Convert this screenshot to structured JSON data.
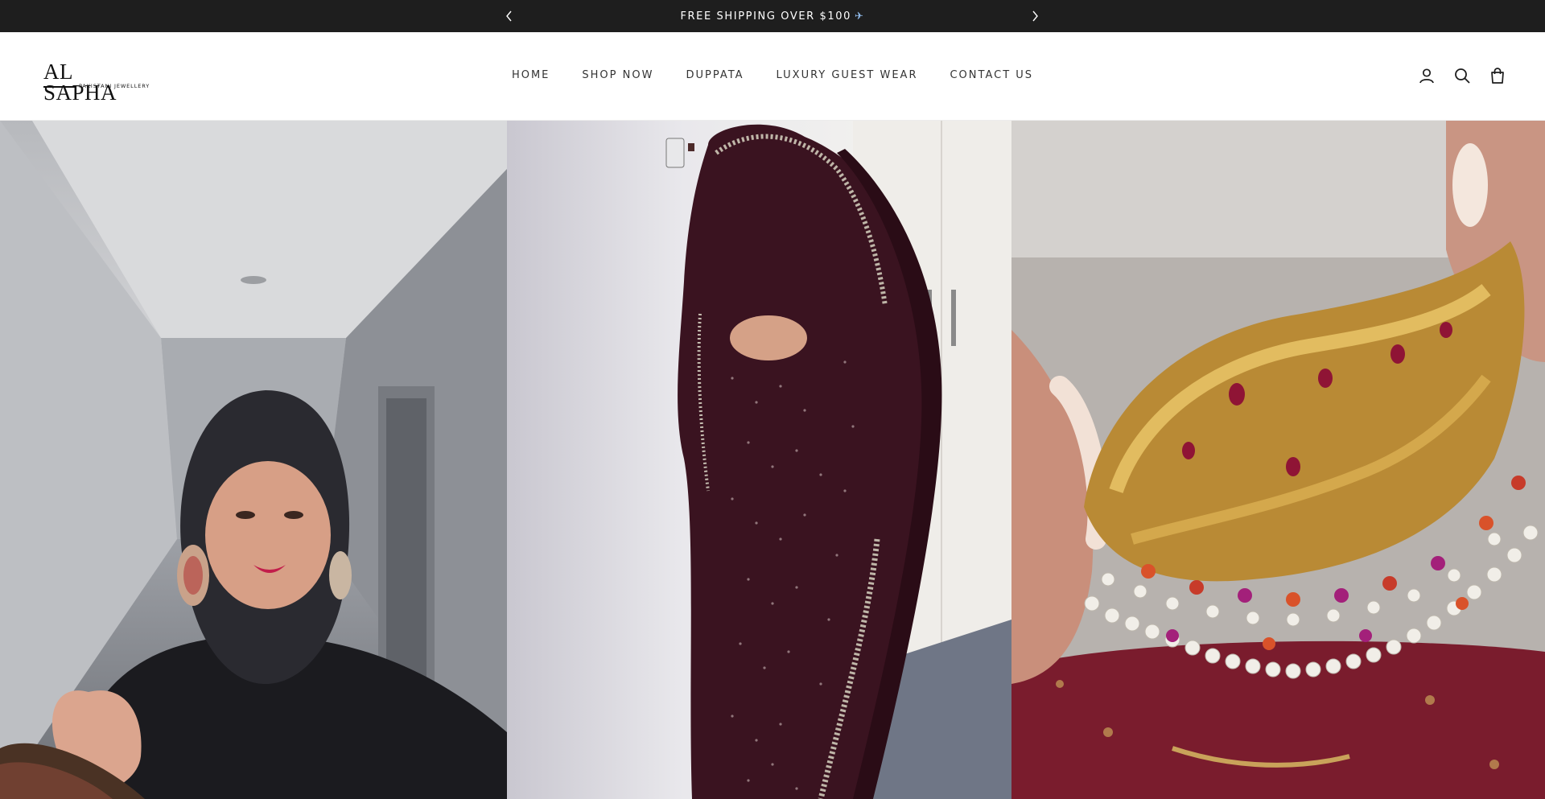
{
  "announcement": {
    "text": "FREE SHIPPING OVER $100",
    "emoji": "✈",
    "prev_icon": "chevron-left-icon",
    "next_icon": "chevron-right-icon"
  },
  "brand": {
    "name": "AL SAPHA",
    "tagline": "PAKISTANI JEWELLERY"
  },
  "nav": {
    "items": [
      {
        "label": "HOME"
      },
      {
        "label": "SHOP NOW"
      },
      {
        "label": "DUPPATA"
      },
      {
        "label": "LUXURY GUEST WEAR"
      },
      {
        "label": "CONTACT US"
      }
    ]
  },
  "header_icons": [
    "account-icon",
    "search-icon",
    "cart-icon"
  ],
  "media": {
    "panels": [
      {
        "subject": "woman-in-hijab-with-earrings"
      },
      {
        "subject": "woman-in-maroon-saree"
      },
      {
        "subject": "gold-jewellery-necklace"
      }
    ]
  },
  "colors": {
    "announcement_bg": "#1e1e1e",
    "announcement_text": "#ffffff",
    "header_bg": "#ffffff",
    "nav_text": "#333333"
  }
}
